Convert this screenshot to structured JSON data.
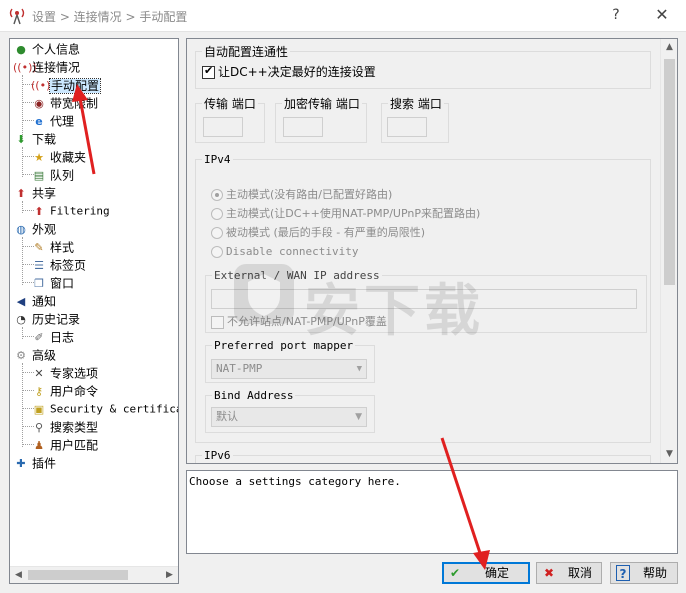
{
  "window": {
    "breadcrumb": "设置 > 连接情况 > 手动配置",
    "help_glyph": "?",
    "close_glyph": "✕"
  },
  "tree": {
    "items": [
      {
        "label": "个人信息",
        "icon": "user-icon"
      },
      {
        "label": "连接情况",
        "icon": "antenna-icon"
      },
      {
        "label": "手动配置",
        "icon": "antenna-icon"
      },
      {
        "label": "带宽限制",
        "icon": "gauge-icon"
      },
      {
        "label": "代理",
        "icon": "ie-icon"
      },
      {
        "label": "下载",
        "icon": "download-arrow-icon"
      },
      {
        "label": "收藏夹",
        "icon": "folder-star-icon"
      },
      {
        "label": "队列",
        "icon": "queue-icon"
      },
      {
        "label": "共享",
        "icon": "upload-arrow-icon"
      },
      {
        "label": "Filtering",
        "icon": "upload-arrow-icon"
      },
      {
        "label": "外观",
        "icon": "globe-icon"
      },
      {
        "label": "样式",
        "icon": "palette-icon"
      },
      {
        "label": "标签页",
        "icon": "tabs-icon"
      },
      {
        "label": "窗口",
        "icon": "window-icon"
      },
      {
        "label": "通知",
        "icon": "speaker-icon"
      },
      {
        "label": "历史记录",
        "icon": "clock-icon"
      },
      {
        "label": "日志",
        "icon": "log-icon"
      },
      {
        "label": "高级",
        "icon": "gear-icon"
      },
      {
        "label": "专家选项",
        "icon": "tools-icon"
      },
      {
        "label": "用户命令",
        "icon": "key-icon"
      },
      {
        "label": "Security & certificat",
        "icon": "lock-icon"
      },
      {
        "label": "搜索类型",
        "icon": "magnifier-icon"
      },
      {
        "label": "用户匹配",
        "icon": "users-icon"
      },
      {
        "label": "插件",
        "icon": "plugin-icon"
      }
    ],
    "selected_label": "手动配置"
  },
  "settings": {
    "autodetect": {
      "legend": "自动配置连通性",
      "checkbox_label": "让DC++决定最好的连接设置",
      "checked": true
    },
    "ports": [
      {
        "legend": "传输 端口",
        "value": ""
      },
      {
        "legend": "加密传输 端口",
        "value": ""
      },
      {
        "legend": "搜索 端口",
        "value": ""
      }
    ],
    "ipv4": {
      "legend": "IPv4",
      "modes": [
        {
          "label": "主动模式(没有路由/已配置好路由)",
          "selected": true
        },
        {
          "label": "主动模式(让DC++使用NAT-PMP/UPnP来配置路由)",
          "selected": false
        },
        {
          "label": "被动模式 (最后的手段 - 有严重的局限性)",
          "selected": false
        },
        {
          "label": "Disable connectivity",
          "selected": false
        }
      ],
      "external_legend": "External / WAN IP address",
      "external_value": "",
      "override_label": "不允许站点/NAT-PMP/UPnP覆盖",
      "override_checked": false,
      "mapper_legend": "Preferred port mapper",
      "mapper_value": "NAT-PMP",
      "bind_legend": "Bind Address",
      "bind_value": "默认"
    },
    "ipv6": {
      "legend": "IPv6"
    }
  },
  "info_text": "Choose a settings category here.",
  "buttons": {
    "ok": "确定",
    "cancel": "取消",
    "help": "帮助"
  },
  "watermark_text": "安下载",
  "colors": {
    "selection": "#cce8ff",
    "annotation_arrow": "#e02020",
    "primary_button_border": "#0078d7"
  }
}
